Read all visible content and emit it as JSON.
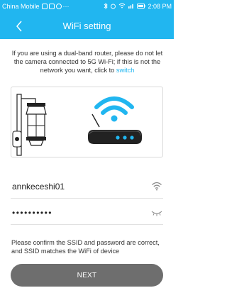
{
  "status_bar": {
    "carrier": "China Mobile",
    "time": "2:08 PM",
    "signal_text": "4G"
  },
  "header": {
    "title": "WiFi setting",
    "back_icon": "chevron-left-icon"
  },
  "info": {
    "text": "If you are using a dual-band router, please do not let the camera connected to 5G Wi-Fi; if this is not the network you want, click to ",
    "link": "switch"
  },
  "form": {
    "ssid_value": "annkeceshi01",
    "password_value": "••••••••••",
    "wifi_icon": "wifi-icon",
    "eye_icon": "eye-closed-icon"
  },
  "confirm_text": "Please confirm the SSID and password are correct, and SSID matches the WiFi of device",
  "next_button": "NEXT",
  "colors": {
    "accent": "#21b6f0",
    "button": "#6e6e6e"
  }
}
